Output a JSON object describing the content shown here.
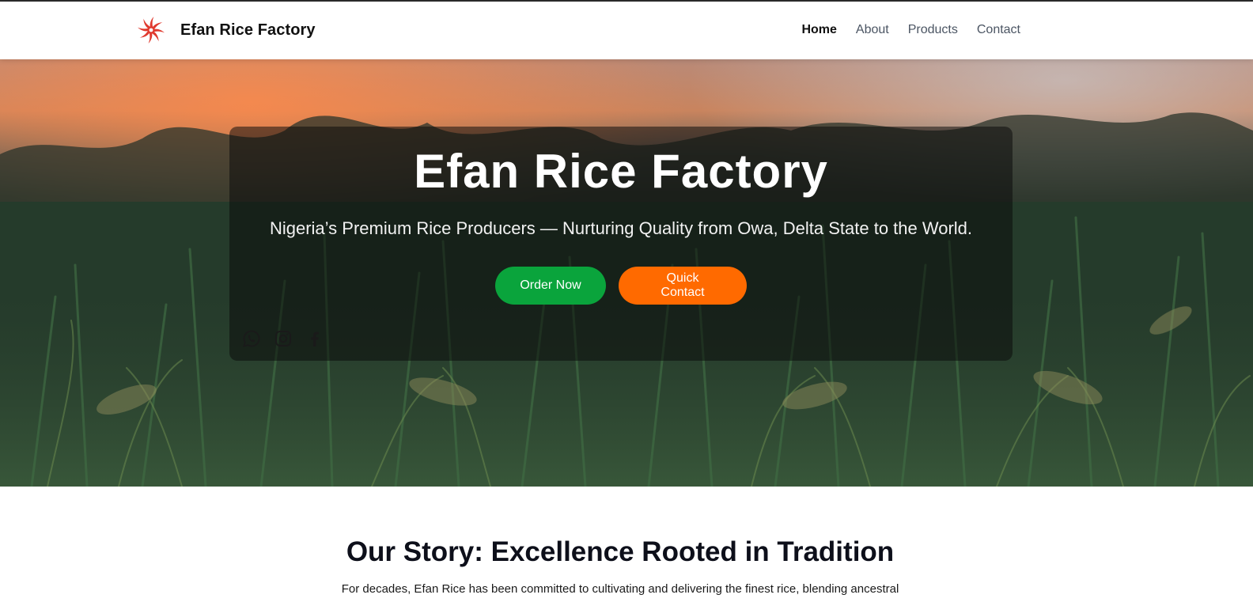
{
  "nav": {
    "brand_name": "Efan Rice Factory",
    "links": [
      {
        "label": "Home",
        "active": true
      },
      {
        "label": "About",
        "active": false
      },
      {
        "label": "Products",
        "active": false
      },
      {
        "label": "Contact",
        "active": false
      }
    ]
  },
  "hero": {
    "title": "Efan Rice Factory",
    "subtitle": "Nigeria’s Premium Rice Producers — Nurturing Quality from Owa, Delta State to the World.",
    "order_button": "Order Now",
    "contact_button": "Quick Contact",
    "social_icons": [
      "whatsapp-icon",
      "instagram-icon",
      "facebook-icon"
    ]
  },
  "story": {
    "title": "Our Story: Excellence Rooted in Tradition",
    "text": "For decades, Efan Rice has been committed to cultivating and delivering the finest rice, blending ancestral"
  },
  "colors": {
    "brand_red": "#e03a2f",
    "order_green": "#0aa43c",
    "contact_orange": "#ff6a00",
    "heading_dark": "#0d0f1a"
  }
}
